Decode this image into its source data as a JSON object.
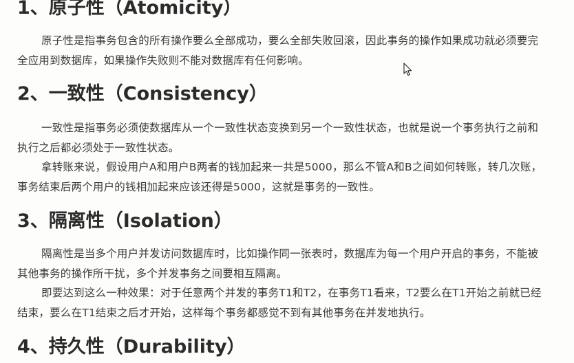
{
  "sections": [
    {
      "heading": "1、原子性（Atomicity）",
      "paragraphs": [
        "原子性是指事务包含的所有操作要么全部成功，要么全部失败回滚，因此事务的操作如果成功就必须要完全应用到数据库，如果操作失败则不能对数据库有任何影响。"
      ]
    },
    {
      "heading": "2、一致性（Consistency）",
      "paragraphs": [
        "一致性是指事务必须使数据库从一个一致性状态变换到另一个一致性状态，也就是说一个事务执行之前和执行之后都必须处于一致性状态。",
        "拿转账来说，假设用户A和用户B两者的钱加起来一共是5000，那么不管A和B之间如何转账，转几次账，事务结束后两个用户的钱相加起来应该还得是5000，这就是事务的一致性。"
      ]
    },
    {
      "heading": "3、隔离性（Isolation）",
      "paragraphs": [
        "隔离性是当多个用户并发访问数据库时，比如操作同一张表时，数据库为每一个用户开启的事务，不能被其他事务的操作所干扰，多个并发事务之间要相互隔离。",
        "即要达到这么一种效果：对于任意两个并发的事务T1和T2，在事务T1看来，T2要么在T1开始之前就已经结束，要么在T1结束之后才开始，这样每个事务都感觉不到有其他事务在并发地执行。"
      ]
    },
    {
      "heading": "4、持久性（Durability）",
      "paragraphs": []
    }
  ]
}
